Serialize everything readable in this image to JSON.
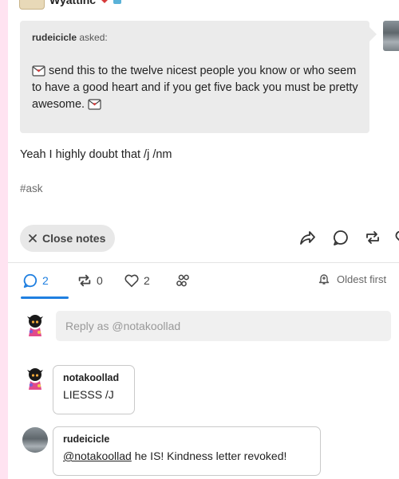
{
  "post": {
    "header_name": "Wyattinc",
    "asker": "rudeicicle",
    "asked_suffix": "asked:",
    "ask_body": "send this to the twelve nicest people you know or who seem to have a good heart and if you get five back you must be pretty awesome.",
    "reply": "Yeah I highly doubt that /j /nm",
    "tag": "#ask"
  },
  "actions": {
    "close_notes_label": "Close notes"
  },
  "notes": {
    "tabs": {
      "replies_count": "2",
      "reblogs_count": "0",
      "likes_count": "2"
    },
    "sort_label": "Oldest first",
    "reply_placeholder": "Reply as @notakoollad",
    "items": [
      {
        "name": "notakoollad",
        "text": "LIESSS /J"
      },
      {
        "name": "rudeicicle",
        "mention": "@notakoollad",
        "text": " he IS! Kindness letter revoked!"
      }
    ]
  },
  "colors": {
    "accent": "#1f7fe0",
    "page_background": "#ffe3f1",
    "ask_background": "#ebebeb"
  }
}
